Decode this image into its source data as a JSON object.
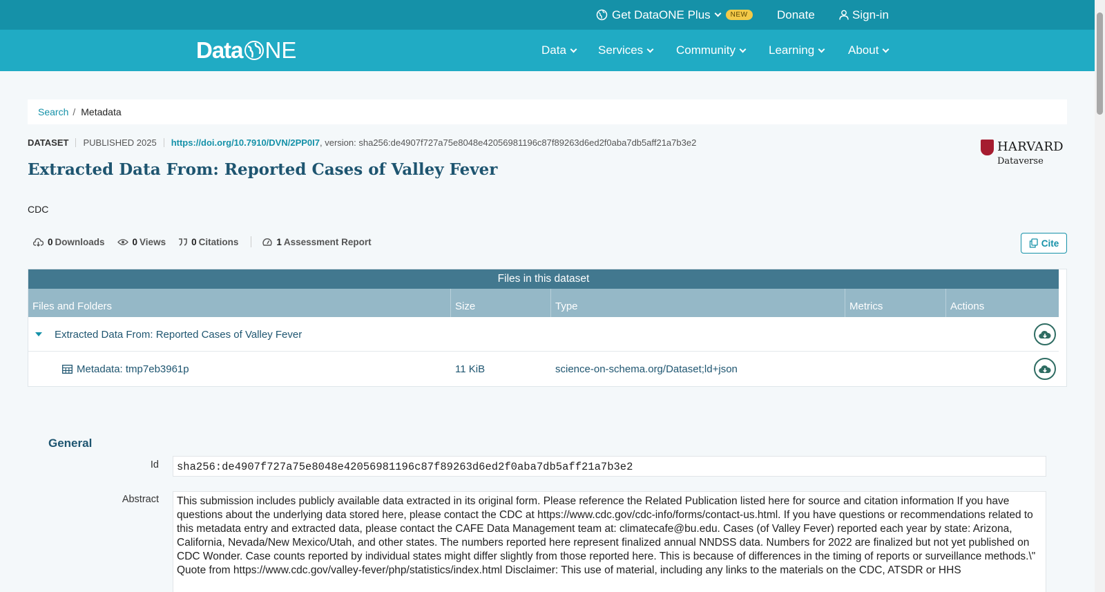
{
  "topbar": {
    "plus_label": "Get DataONE Plus",
    "new_badge": "NEW",
    "donate": "Donate",
    "signin": "Sign-in"
  },
  "nav": {
    "logo_data": "Data",
    "logo_one": "NE",
    "items": [
      "Data",
      "Services",
      "Community",
      "Learning",
      "About"
    ]
  },
  "breadcrumb": {
    "search": "Search",
    "separator": "/",
    "current": "Metadata"
  },
  "dataset": {
    "type": "DATASET",
    "published": "PUBLISHED 2025",
    "doi": "https://doi.org/10.7910/DVN/2PP0I7",
    "version": ", version: sha256:de4907f727a75e8048e42056981196c87f89263d6ed2f0aba7db5aff21a7b3e2",
    "title": "Extracted Data From: Reported Cases of Valley Fever",
    "creator": "CDC",
    "repository_name": "HARVARD",
    "repository_sub": "Dataverse"
  },
  "metrics": {
    "downloads": "0",
    "downloads_label": "Downloads",
    "views": "0",
    "views_label": "Views",
    "citations": "0",
    "citations_label": "Citations",
    "assessment": "1",
    "assessment_label": "Assessment Report",
    "cite_label": "Cite"
  },
  "files": {
    "header": "Files in this dataset",
    "columns": [
      "Files and Folders",
      "Size",
      "Type",
      "Metrics",
      "Actions"
    ],
    "folder": "Extracted Data From: Reported Cases of Valley Fever",
    "rows": [
      {
        "name": "Metadata: tmp7eb3961p",
        "size": "11 KiB",
        "type": "science-on-schema.org/Dataset;ld+json"
      }
    ]
  },
  "general": {
    "heading": "General",
    "id_label": "Id",
    "id_value": "sha256:de4907f727a75e8048e42056981196c87f89263d6ed2f0aba7db5aff21a7b3e2",
    "abstract_label": "Abstract",
    "abstract_value": "This submission includes publicly available data extracted in its original form. Please reference the Related Publication listed here for source and citation information If you have questions about the underlying data stored here, please contact the CDC at https://www.cdc.gov/cdc-info/forms/contact-us.html. If you have questions or recommendations related to this metadata entry and extracted data, please contact the CAFE Data Management team at: climatecafe@bu.edu. Cases (of Valley Fever) reported each year by state: Arizona, California, Nevada/New Mexico/Utah, and other states. The numbers reported here represent finalized annual NNDSS data. Numbers for 2022 are finalized but not yet published on CDC Wonder. Case counts reported by individual states might differ slightly from those reported here. This is because of differences in the timing of reports or surveillance methods.\\\" Quote from https://www.cdc.gov/valley-fever/php/statistics/index.html Disclaimer: This use of material, including any links to the materials on the CDC, ATSDR or HHS"
  },
  "colors": {
    "topbar": "#1591a8",
    "navbar": "#20abc4",
    "title": "#1e5570",
    "table_header": "#42788f",
    "table_columns": "#95b8c7",
    "badge": "#f3c948"
  }
}
